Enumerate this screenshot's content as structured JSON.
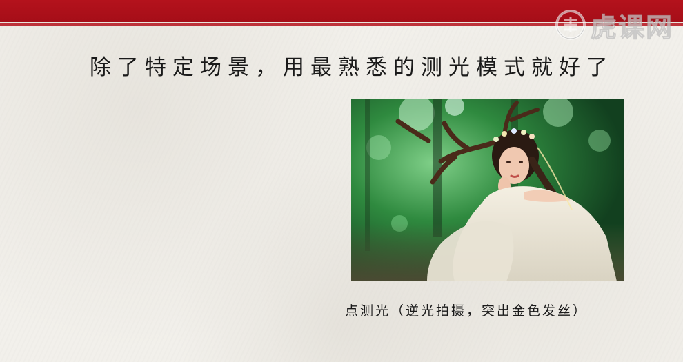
{
  "slide": {
    "headline": "除了特定场景，用最熟悉的测光模式就好了",
    "caption": "点测光（逆光拍摄，突出金色发丝）"
  },
  "watermark": {
    "text": "虎课网",
    "icon": "tiger-logo-icon"
  },
  "photo": {
    "subject": "photo-girl-with-antlers"
  },
  "colors": {
    "banner_red": "#b4121c",
    "paper": "#f2f0eb",
    "text": "#1a1a1a"
  }
}
